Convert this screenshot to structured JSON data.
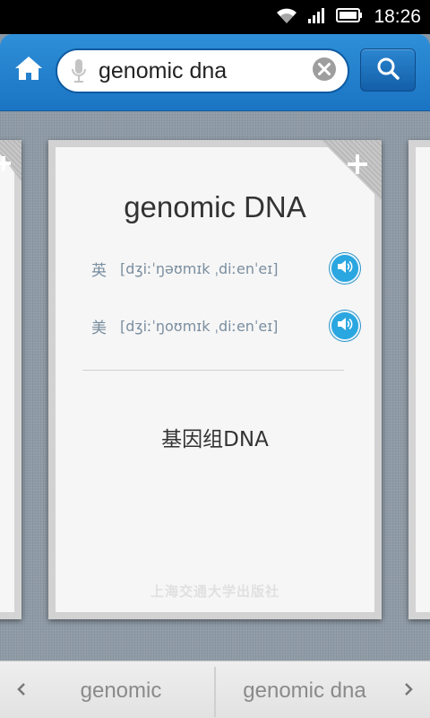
{
  "status_bar": {
    "time": "18:26"
  },
  "header": {
    "search": {
      "value": "genomic dna",
      "placeholder": ""
    }
  },
  "card": {
    "word": "genomic DNA",
    "pronunciations": [
      {
        "label": "英",
        "phonetic": "[dʒiːˈŋəʊmɪk ˌdiːenˈeɪ]"
      },
      {
        "label": "美",
        "phonetic": "[dʒiːˈŋoʊmɪk ˌdiːenˈeɪ]"
      }
    ],
    "definition": "基因组DNA",
    "publisher": "上海交通大学出版社"
  },
  "bottom_nav": {
    "prev_word": "genomic",
    "next_word": "genomic dna"
  },
  "colors": {
    "header_blue": "#1f7fcc",
    "speaker_blue": "#2aa6e0"
  }
}
